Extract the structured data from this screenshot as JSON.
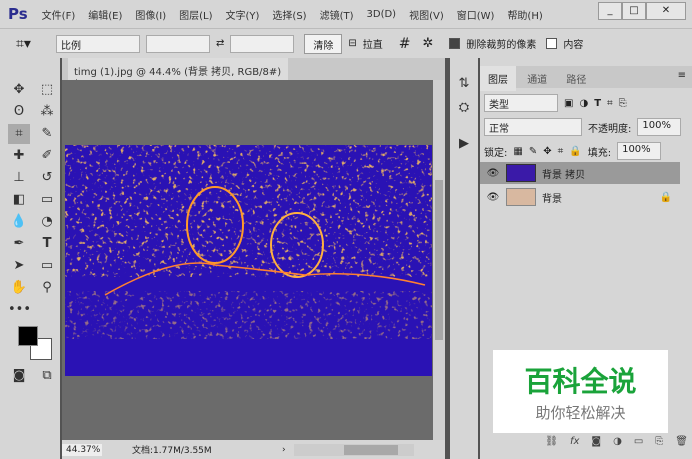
{
  "app": {
    "logo": "Ps",
    "window_controls": [
      "_",
      "□",
      "✕"
    ]
  },
  "menu": [
    "文件(F)",
    "编辑(E)",
    "图像(I)",
    "图层(L)",
    "文字(Y)",
    "选择(S)",
    "滤镜(T)",
    "3D(D)",
    "视图(V)",
    "窗口(W)",
    "帮助(H)"
  ],
  "options": {
    "ratio": "比例",
    "clear": "清除",
    "straighten": "拉直",
    "delete_cropped": "删除裁剪的像素",
    "content_aware": "内容",
    "swap_icon": "⇄"
  },
  "document": {
    "tab_title": "timg (1).jpg @ 44.4% (背景 拷贝, RGB/8#) *",
    "close": "×",
    "zoom": "44.37%",
    "doc_size": "文档:1.77M/3.55M"
  },
  "layers_panel": {
    "tabs": [
      "图层",
      "通道",
      "路径"
    ],
    "filter": "类型",
    "blend_mode": "正常",
    "opacity_label": "不透明度:",
    "opacity": "100%",
    "lock_label": "锁定:",
    "fill_label": "填充:",
    "fill": "100%",
    "layers": [
      {
        "name": "背景 拷贝",
        "selected": true,
        "locked": false
      },
      {
        "name": "背景",
        "selected": false,
        "locked": true
      }
    ]
  },
  "watermark": {
    "title": "百科全说",
    "subtitle": "助你轻松解决"
  }
}
